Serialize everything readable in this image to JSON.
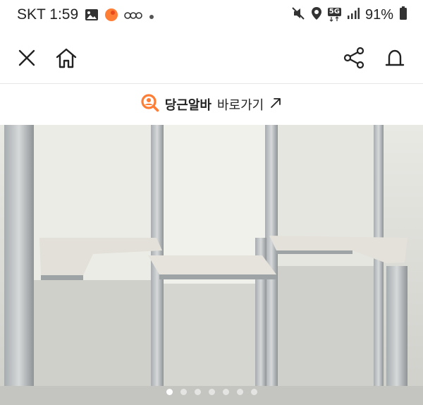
{
  "status_bar": {
    "carrier_time": "SKT 1:59",
    "network": "5G",
    "battery": "91%",
    "icons": [
      "gallery-icon",
      "daangn-notification-icon",
      "voicemail-icon",
      "more-dot-icon",
      "mute-icon",
      "location-icon",
      "5g-icon",
      "signal-icon",
      "battery-icon"
    ]
  },
  "app_bar": {
    "close_icon": "close-icon",
    "home_icon": "home-icon",
    "share_icon": "share-icon",
    "alert_icon": "siren-icon"
  },
  "banner": {
    "brand": "당근알바",
    "link_text": "바로가기",
    "accent": "#ff7e36"
  },
  "photo": {
    "description_icon": "product-photo",
    "page_count": 7,
    "current_page": 1
  }
}
